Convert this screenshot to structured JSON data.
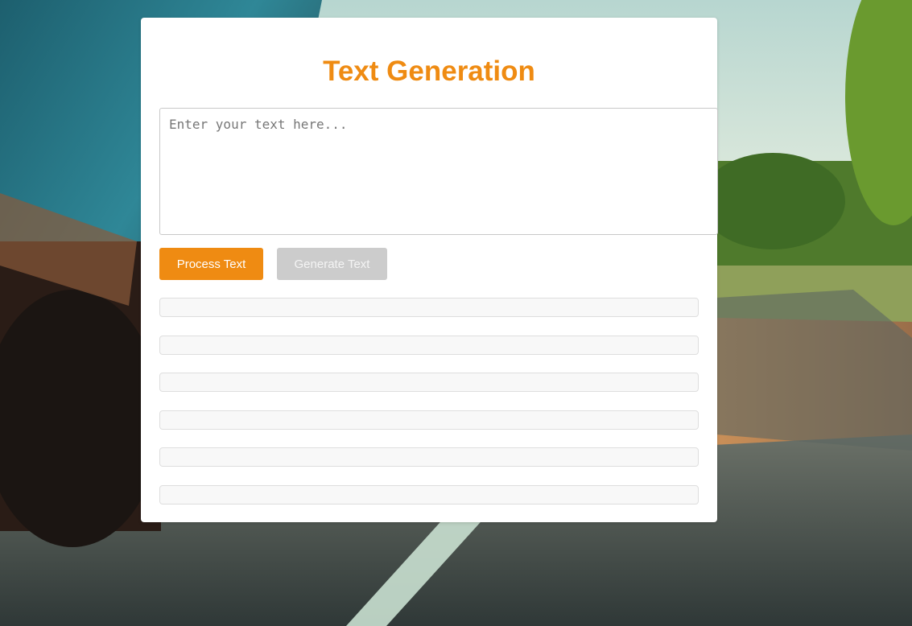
{
  "page": {
    "title": "Text Generation"
  },
  "input": {
    "placeholder": "Enter your text here...",
    "value": ""
  },
  "buttons": {
    "process_label": "Process Text",
    "generate_label": "Generate Text"
  },
  "results": [
    "",
    "",
    "",
    "",
    "",
    ""
  ],
  "colors": {
    "accent": "#ef8b12",
    "disabled_button": "#cccccc",
    "result_background": "#f8f8f8"
  },
  "background": {
    "description_icon": "car-road-photo"
  }
}
